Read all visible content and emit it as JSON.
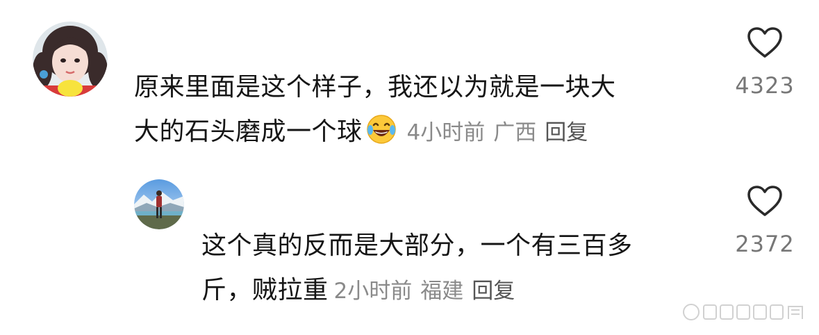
{
  "comments": [
    {
      "text_line1": "原来里面是这个样子，我还以为就是一块大",
      "text_line2": "大的石头磨成一个球",
      "emoji": "laughing-tears-emoji",
      "time": "4小时前",
      "location": "广西",
      "reply_label": "回复",
      "like_count": "4323",
      "icon": "heart-outline-icon"
    },
    {
      "text_line1": "这个真的反而是大部分，一个有三百多",
      "text_line2": "斤，贼拉重",
      "time": "2小时前",
      "location": "福建",
      "reply_label": "回复",
      "like_count": "2372",
      "icon": "heart-outline-icon"
    }
  ],
  "colors": {
    "text": "#161616",
    "meta": "#8a8a8a",
    "reply": "#555555",
    "like_count": "#777777",
    "icon_stroke": "#2a2a2a"
  }
}
